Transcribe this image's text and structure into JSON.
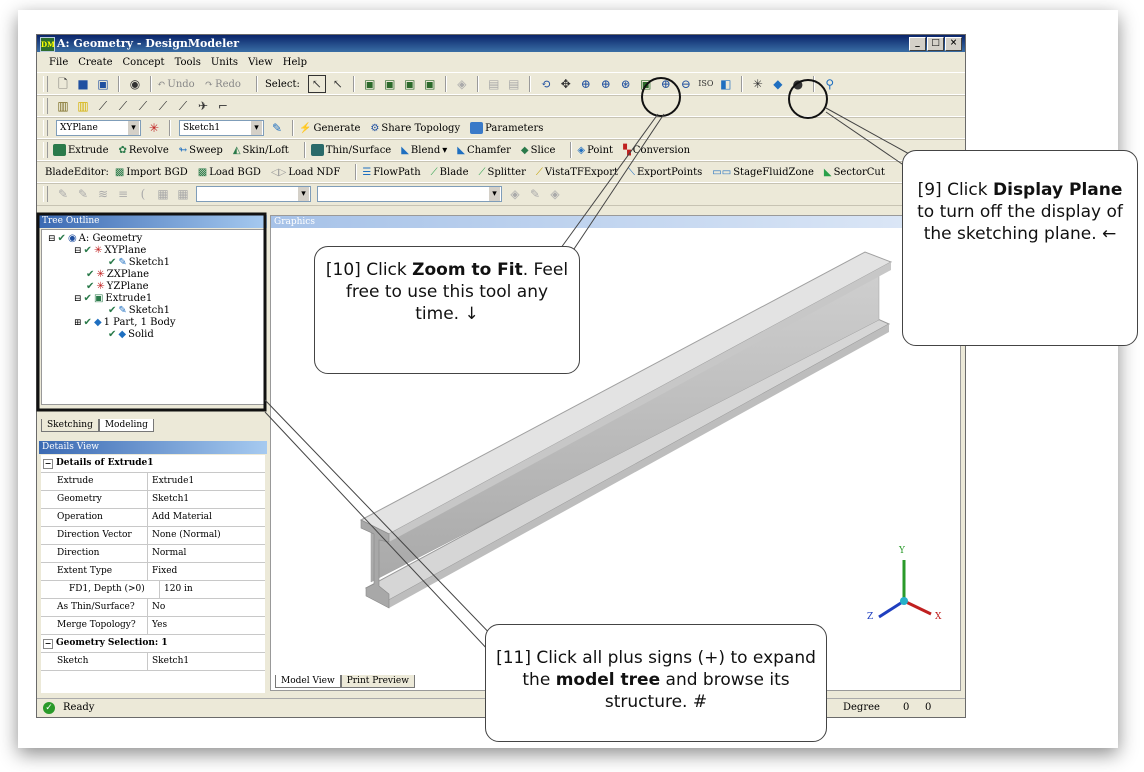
{
  "window": {
    "title": "A: Geometry - DesignModeler",
    "min": "_",
    "max": "□",
    "close": "×"
  },
  "menu": [
    "File",
    "Create",
    "Concept",
    "Tools",
    "Units",
    "View",
    "Help"
  ],
  "toolbar1": {
    "undo": "Undo",
    "redo": "Redo",
    "select": "Select:"
  },
  "toolbar3": {
    "plane_value": "XYPlane",
    "sketch_value": "Sketch1",
    "generate": "Generate",
    "share_topology": "Share Topology",
    "parameters": "Parameters"
  },
  "toolbar4": {
    "extrude": "Extrude",
    "revolve": "Revolve",
    "sweep": "Sweep",
    "skinloft": "Skin/Loft",
    "thinsurface": "Thin/Surface",
    "blend": "Blend",
    "chamfer": "Chamfer",
    "slice": "Slice",
    "point": "Point",
    "conversion": "Conversion"
  },
  "toolbar5": {
    "bladeeditor": "BladeEditor:",
    "import_bgd": "Import BGD",
    "load_bgd": "Load BGD",
    "load_ndf": "Load NDF",
    "flowpath": "FlowPath",
    "blade": "Blade",
    "splitter": "Splitter",
    "vistatf": "VistaTFExport",
    "exportpoints": "ExportPoints",
    "stagefluid": "StageFluidZone",
    "sectorcut": "SectorCut"
  },
  "tree": {
    "header": "Tree Outline",
    "nodes": [
      "A: Geometry",
      "XYPlane",
      "Sketch1",
      "ZXPlane",
      "YZPlane",
      "Extrude1",
      "Sketch1",
      "1 Part, 1 Body",
      "Solid"
    ]
  },
  "tabs": {
    "sketching": "Sketching",
    "modeling": "Modeling"
  },
  "details": {
    "header": "Details View",
    "section1": "Details of Extrude1",
    "rows": [
      {
        "k": "Extrude",
        "v": "Extrude1"
      },
      {
        "k": "Geometry",
        "v": "Sketch1"
      },
      {
        "k": "Operation",
        "v": "Add Material"
      },
      {
        "k": "Direction Vector",
        "v": "None (Normal)"
      },
      {
        "k": "Direction",
        "v": "Normal"
      },
      {
        "k": "Extent Type",
        "v": "Fixed"
      },
      {
        "k": "FD1, Depth (>0)",
        "v": "120 in"
      },
      {
        "k": "As Thin/Surface?",
        "v": "No"
      },
      {
        "k": "Merge Topology?",
        "v": "Yes"
      }
    ],
    "section2": "Geometry Selection: 1",
    "rows2": [
      {
        "k": "Sketch",
        "v": "Sketch1"
      }
    ]
  },
  "graphics": {
    "header": "Graphics",
    "tab_model": "Model View",
    "tab_print": "Print Preview",
    "axis_x": "X",
    "axis_y": "Y",
    "axis_z": "Z"
  },
  "status": {
    "ready": "Ready",
    "degree": "Degree",
    "v1": "0",
    "v2": "0"
  },
  "callouts": {
    "c9": {
      "pre": "[9] Click ",
      "bold": "Display Plane",
      "post": " to turn off the display of the sketching plane. ←"
    },
    "c10": {
      "pre": "[10] Click ",
      "bold": "Zoom to Fit",
      "post": ". Feel free to use this tool any time. ↓"
    },
    "c11": {
      "pre": "[11] Click all plus signs (+) to expand the ",
      "bold": "model tree",
      "post": " and browse its structure. #"
    }
  }
}
